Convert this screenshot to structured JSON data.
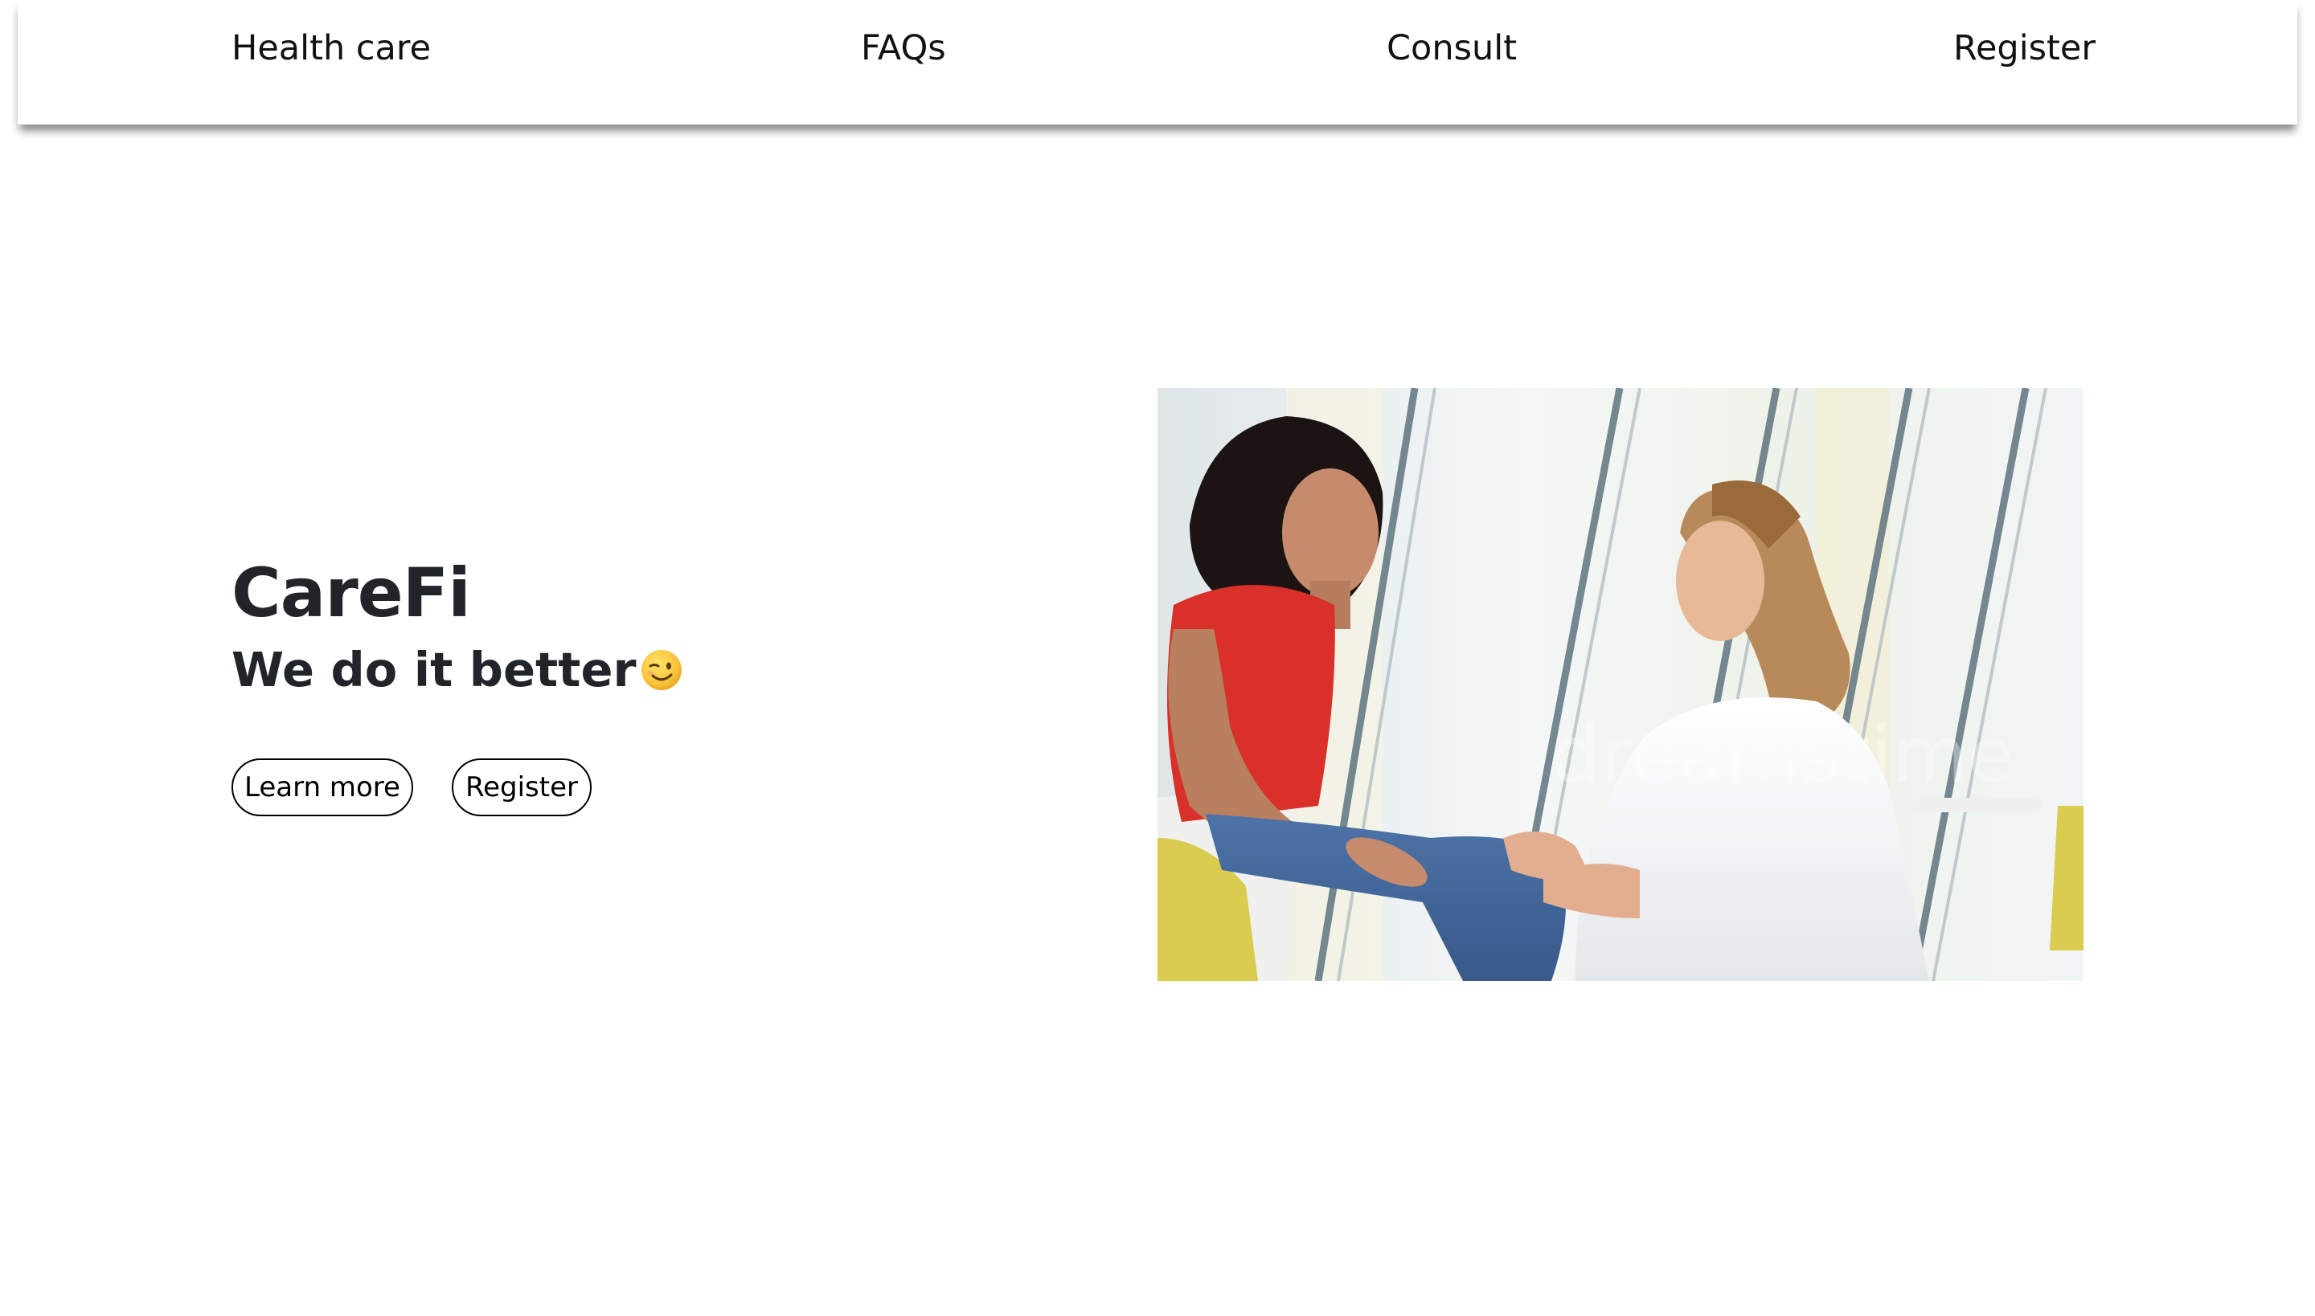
{
  "nav": {
    "items": [
      {
        "label": "Health care"
      },
      {
        "label": "FAQs"
      },
      {
        "label": "Consult"
      },
      {
        "label": "Register"
      }
    ]
  },
  "hero": {
    "brand": "CareFi",
    "tagline": "We do it better",
    "tagline_emoji": "winking-face-icon",
    "buttons": {
      "learn_more": "Learn more",
      "register": "Register"
    },
    "image": {
      "watermark": "dreamstime"
    }
  },
  "colors": {
    "text": "#212529",
    "shirt_red": "#d9302a",
    "chair_yellow": "#d8c84a"
  }
}
